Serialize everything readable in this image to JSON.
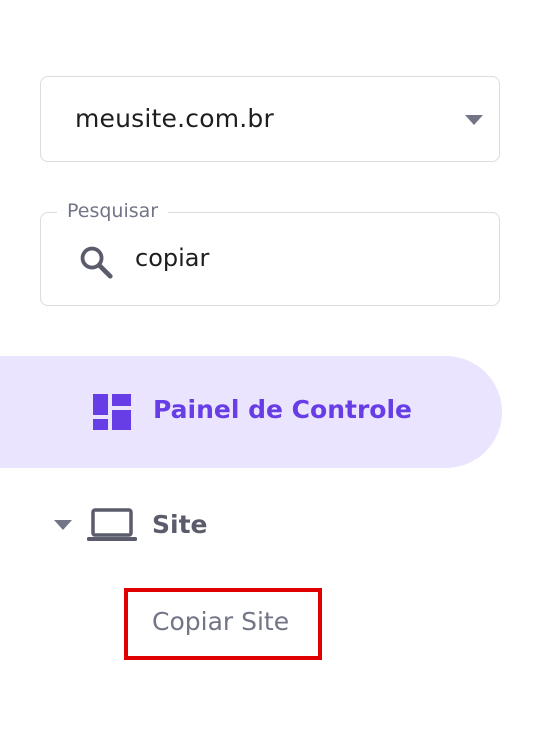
{
  "domain_select": {
    "value": "meusite.com.br",
    "caret_icon": "caret-down-icon"
  },
  "search": {
    "legend": "Pesquisar",
    "value": "copiar",
    "icon": "search-icon"
  },
  "nav": {
    "dashboard": {
      "label": "Painel de Controle",
      "icon": "dashboard-grid-icon",
      "active": true
    },
    "site": {
      "label": "Site",
      "icon": "laptop-icon",
      "expanded": true,
      "children": [
        {
          "label": "Copiar Site"
        }
      ]
    }
  },
  "colors": {
    "accent": "#673de6",
    "active_bg": "#ebe4ff",
    "highlight_border": "#e00000",
    "muted_text": "#727586",
    "border": "#dadce0"
  }
}
